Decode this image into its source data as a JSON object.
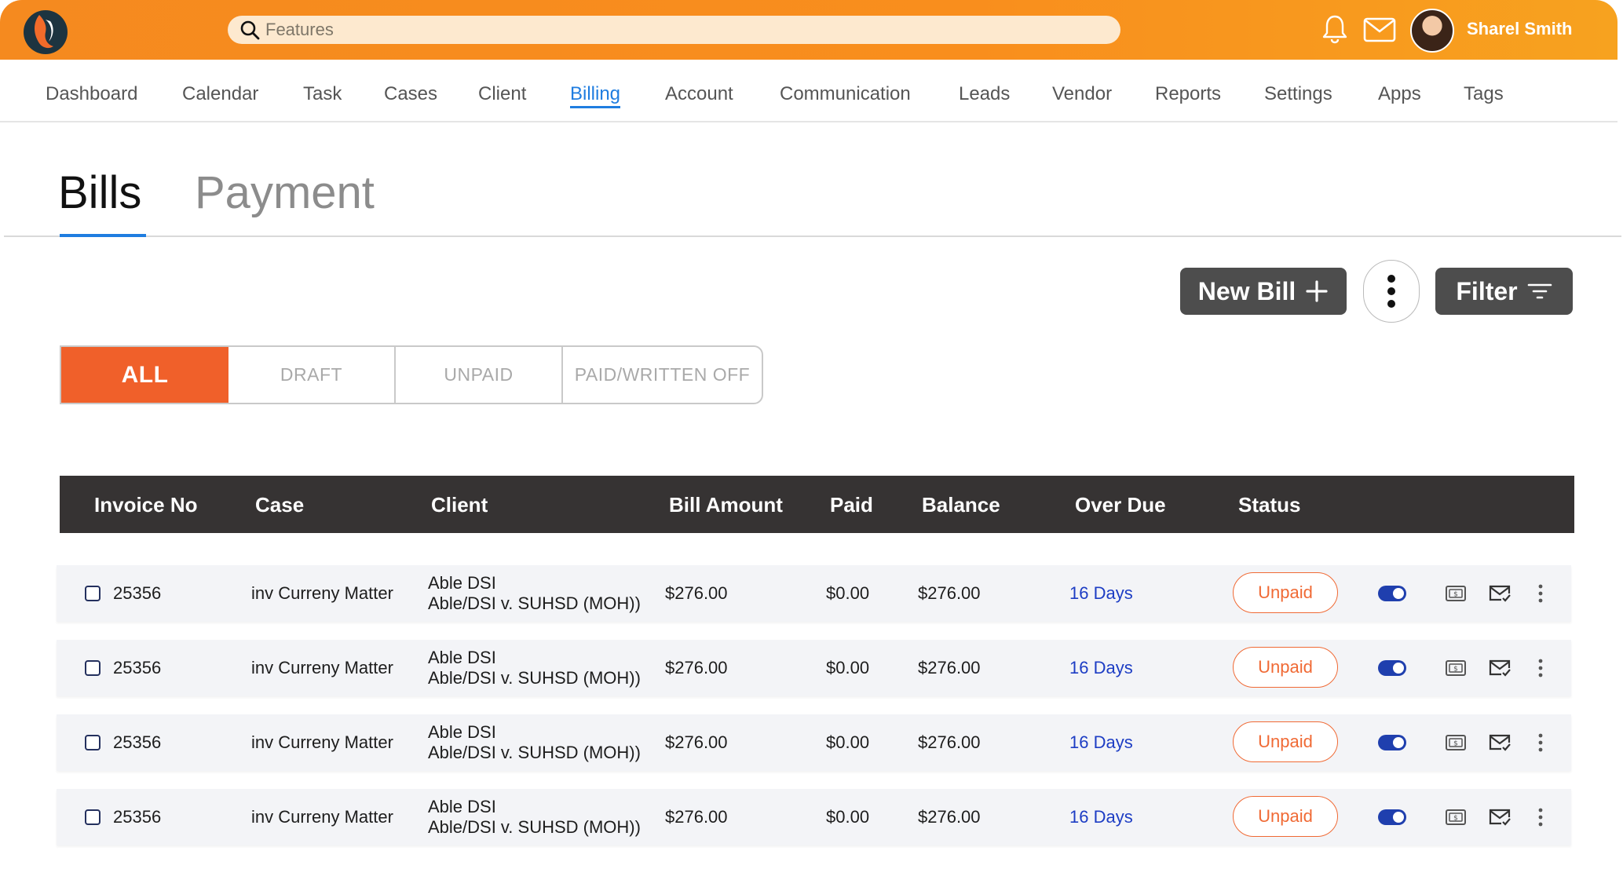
{
  "header": {
    "search_placeholder": "Features",
    "user_name": "Sharel Smith",
    "accent_color": "#f98e1d",
    "icons": [
      "app-logo-icon",
      "search-icon",
      "bell-icon",
      "mail-icon",
      "avatar"
    ]
  },
  "nav": {
    "items": [
      "Dashboard",
      "Calendar",
      "Task",
      "Cases",
      "Client",
      "Billing",
      "Account",
      "Communication",
      "Leads",
      "Vendor",
      "Reports",
      "Settings",
      "Apps",
      "Tags"
    ],
    "active": "Billing"
  },
  "tabs": {
    "bills": "Bills",
    "payment": "Payment",
    "active": "Bills"
  },
  "actions": {
    "new_bill": "New Bill",
    "filter": "Filter"
  },
  "segments": [
    "ALL",
    "DRAFT",
    "UNPAID",
    "PAID/WRITTEN OFF"
  ],
  "table": {
    "columns": [
      "Invoice No",
      "Case",
      "Client",
      "Bill Amount",
      "Paid",
      "Balance",
      "Over Due",
      "Status"
    ],
    "rows": [
      {
        "invoice": "25356",
        "case": "inv Curreny Matter",
        "client_line1": "Able DSI",
        "client_line2": "Able/DSI v. SUHSD (MOH))",
        "amount": "$276.00",
        "paid": "$0.00",
        "balance": "$276.00",
        "overdue": "16 Days",
        "status": "Unpaid"
      },
      {
        "invoice": "25356",
        "case": "inv Curreny Matter",
        "client_line1": "Able DSI",
        "client_line2": "Able/DSI v. SUHSD (MOH))",
        "amount": "$276.00",
        "paid": "$0.00",
        "balance": "$276.00",
        "overdue": "16 Days",
        "status": "Unpaid"
      },
      {
        "invoice": "25356",
        "case": "inv Curreny Matter",
        "client_line1": "Able DSI",
        "client_line2": "Able/DSI v. SUHSD (MOH))",
        "amount": "$276.00",
        "paid": "$0.00",
        "balance": "$276.00",
        "overdue": "16 Days",
        "status": "Unpaid"
      },
      {
        "invoice": "25356",
        "case": "inv Curreny Matter",
        "client_line1": "Able DSI",
        "client_line2": "Able/DSI v. SUHSD (MOH))",
        "amount": "$276.00",
        "paid": "$0.00",
        "balance": "$276.00",
        "overdue": "16 Days",
        "status": "Unpaid"
      }
    ]
  },
  "colors": {
    "active_tab": "#1f7de0",
    "segment_active": "#f0602a",
    "table_header": "#363333",
    "overdue": "#1d3dc4",
    "status_unpaid": "#f06a35",
    "toggle_on": "#1f3fae"
  }
}
